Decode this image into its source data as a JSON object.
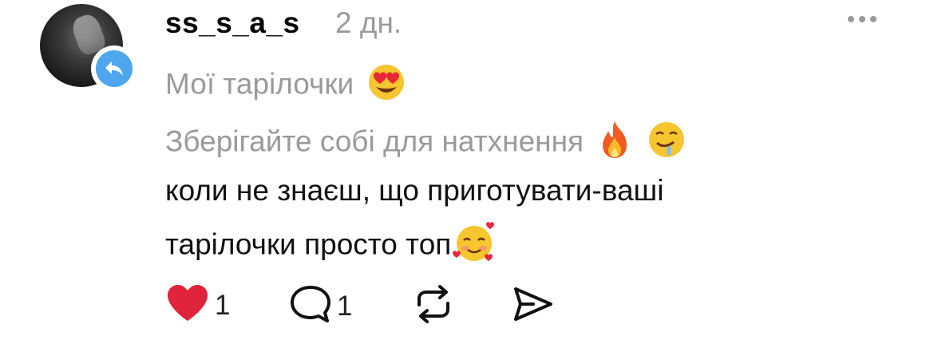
{
  "comment": {
    "username": "ss_s_a_s",
    "time": "2 дн.",
    "lines": [
      "Мої тарілочки",
      "Зберігайте собі для натхнення",
      "коли не знаєш, що приготувати-ваші",
      "тарілочки просто топ"
    ],
    "emoji": {
      "line1": [
        "heart-eyes-emoji"
      ],
      "line2": [
        "fire-emoji",
        "drooling-emoji"
      ],
      "line4": [
        "smiling-face-with-hearts-emoji"
      ]
    }
  },
  "actions": {
    "like_count": "1",
    "reply_count": "1",
    "liked": true
  },
  "colors": {
    "accent_like": "#e0243c",
    "reply_badge": "#4da6ee",
    "secondary_text": "#9a9a9a"
  },
  "icons": [
    "reply-arrow-icon",
    "more-icon",
    "heart-icon",
    "comment-icon",
    "repost-icon",
    "share-icon"
  ]
}
